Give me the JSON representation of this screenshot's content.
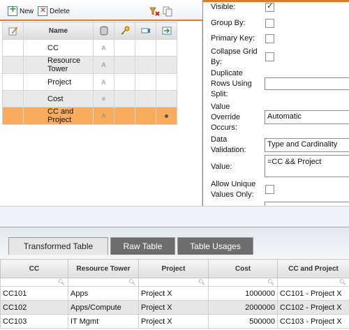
{
  "toolbar": {
    "new_label": "New",
    "delete_label": "Delete"
  },
  "grid": {
    "name_header": "Name",
    "rows": [
      {
        "name": "CC",
        "type_glyph": "A"
      },
      {
        "name": "Resource Tower",
        "type_glyph": "A"
      },
      {
        "name": "Project",
        "type_glyph": "A"
      },
      {
        "name": "Cost",
        "type_glyph": "#"
      },
      {
        "name": "CC and Project",
        "type_glyph": "A"
      }
    ],
    "selected_index": 4
  },
  "properties": {
    "visible_label": "Visible:",
    "group_by_label": "Group By:",
    "primary_key_label": "Primary Key:",
    "collapse_label": "Collapse Grid By:",
    "duplicate_label": "Duplicate Rows Using Split:",
    "override_label": "Value Override Occurs:",
    "override_value": "Automatic",
    "validation_label": "Data Validation:",
    "validation_value": "Type and Cardinality",
    "value_label": "Value:",
    "value_value": "=CC && Project",
    "unique_label": "Allow Unique Values Only:",
    "visible_checked": true
  },
  "tabs": {
    "transformed": "Transformed Table",
    "raw": "Raw Table",
    "usages": "Table Usages"
  },
  "table": {
    "headers": [
      "CC",
      "Resource Tower",
      "Project",
      "Cost",
      "CC and Project"
    ],
    "filter_icon": "magnifier-icon",
    "rows": [
      [
        "CC101",
        "Apps",
        "Project X",
        "1000000",
        "CC101 - Project X"
      ],
      [
        "CC102",
        "Apps/Compute",
        "Project X",
        "2000000",
        "CC102 - Project X"
      ],
      [
        "CC103",
        "IT Mgmt",
        "Project X",
        "500000",
        "CC103 - Project X"
      ]
    ]
  },
  "colors": {
    "accent": "#e87722",
    "selected_row": "#f9ad5c",
    "inactive_tab": "#6d6d6d"
  }
}
